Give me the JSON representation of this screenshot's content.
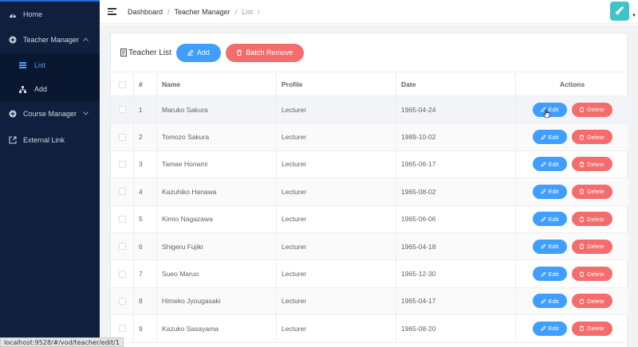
{
  "sidebar": {
    "items": [
      {
        "label": "Home",
        "icon": "dashboard-icon"
      },
      {
        "label": "Teacher Manager",
        "icon": "plus-circle-icon"
      },
      {
        "label": "List",
        "icon": "table-icon"
      },
      {
        "label": "Add",
        "icon": "tree-icon"
      },
      {
        "label": "Course Manager",
        "icon": "plus-circle-icon"
      },
      {
        "label": "External Link",
        "icon": "external-link-icon"
      }
    ]
  },
  "header": {
    "breadcrumb": [
      "Dashboard",
      "Teacher Manager",
      "List"
    ],
    "separator": "/"
  },
  "card": {
    "title": "Teacher List",
    "add_label": "Add",
    "batch_remove_label": "Batch Remove"
  },
  "table": {
    "columns": [
      "#",
      "Name",
      "Profile",
      "Date",
      "Actions"
    ],
    "edit_label": "Edit",
    "delete_label": "Delete",
    "rows": [
      {
        "num": "1",
        "name": "Maruko Sakura",
        "profile": "Lecturer",
        "date": "1965-04-24"
      },
      {
        "num": "2",
        "name": "Tomozo Sakura",
        "profile": "Lecturer",
        "date": "1989-10-02"
      },
      {
        "num": "3",
        "name": "Tamae Honami",
        "profile": "Lecturer",
        "date": "1965-06-17"
      },
      {
        "num": "4",
        "name": "Kazuhiko Hanawa",
        "profile": "Lecturer",
        "date": "1965-08-02"
      },
      {
        "num": "5",
        "name": "Kimio Nagazawa",
        "profile": "Lecturer",
        "date": "1965-06-06"
      },
      {
        "num": "6",
        "name": "Shigeru Fujiki",
        "profile": "Lecturer",
        "date": "1965-04-18"
      },
      {
        "num": "7",
        "name": "Sueo Maruo",
        "profile": "Lecturer",
        "date": "1965-12-30"
      },
      {
        "num": "8",
        "name": "Himeko Jyougasaki",
        "profile": "Lecturer",
        "date": "1965-04-17"
      },
      {
        "num": "9",
        "name": "Kazuko Sasayama",
        "profile": "Lecturer",
        "date": "1965-08-20"
      }
    ]
  },
  "status_url": "localhost:9528/#/vod/teacher/edit/1",
  "colors": {
    "primary": "#409eff",
    "danger": "#f56c6c",
    "sidebar": "#0f1f3d",
    "active": "#4a9ff5"
  }
}
